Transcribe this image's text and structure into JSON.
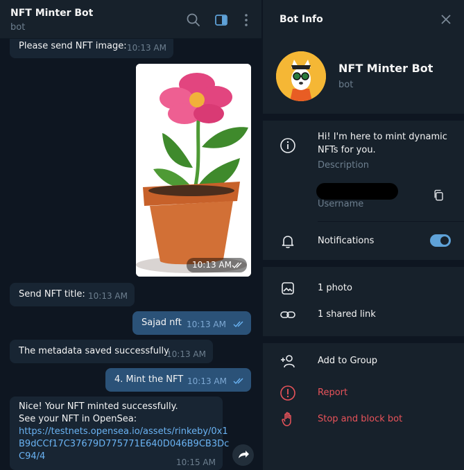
{
  "chat": {
    "title": "NFT Minter Bot",
    "subtitle": "bot",
    "messages": [
      {
        "dir": "in",
        "text": "Please send NFT image:",
        "time": "10:13 AM"
      },
      {
        "dir": "in",
        "image": "flower-pot",
        "time": "10:13 AM"
      },
      {
        "dir": "in",
        "text": "Send NFT title:",
        "time": "10:13 AM"
      },
      {
        "dir": "out",
        "text": "Sajad nft",
        "time": "10:13 AM"
      },
      {
        "dir": "in",
        "text": "The metadata saved successfully.",
        "time": "10:13 AM"
      },
      {
        "dir": "out",
        "text": "4. Mint the NFT",
        "time": "10:13 AM"
      },
      {
        "dir": "in",
        "lines": [
          "Nice! Your NFT minted successfully.",
          "See your NFT in OpenSea:"
        ],
        "link_lines": [
          "https://testnets.opensea.io/assets/rinkeby/0x1",
          "B9dCCf17C37679D775771E640D046B9CB3Dc",
          "C94/4"
        ],
        "time": "10:15 AM"
      }
    ]
  },
  "info": {
    "title": "Bot Info",
    "name": "NFT Minter Bot",
    "type": "bot",
    "description_lines": [
      "Hi! I'm here to mint dynamic",
      "NFTs for you."
    ],
    "description_label": "Description",
    "username_label": "Username",
    "notifications_label": "Notifications",
    "notifications_on": true,
    "photos": "1 photo",
    "shared_links": "1 shared link",
    "add_to_group": "Add to Group",
    "report": "Report",
    "stop_block": "Stop and block bot"
  },
  "colors": {
    "bg": "#0e1621",
    "panel": "#17212b",
    "incoming": "#182533",
    "outgoing": "#2b5278",
    "accent": "#5fa2d8",
    "danger": "#e9535a"
  }
}
